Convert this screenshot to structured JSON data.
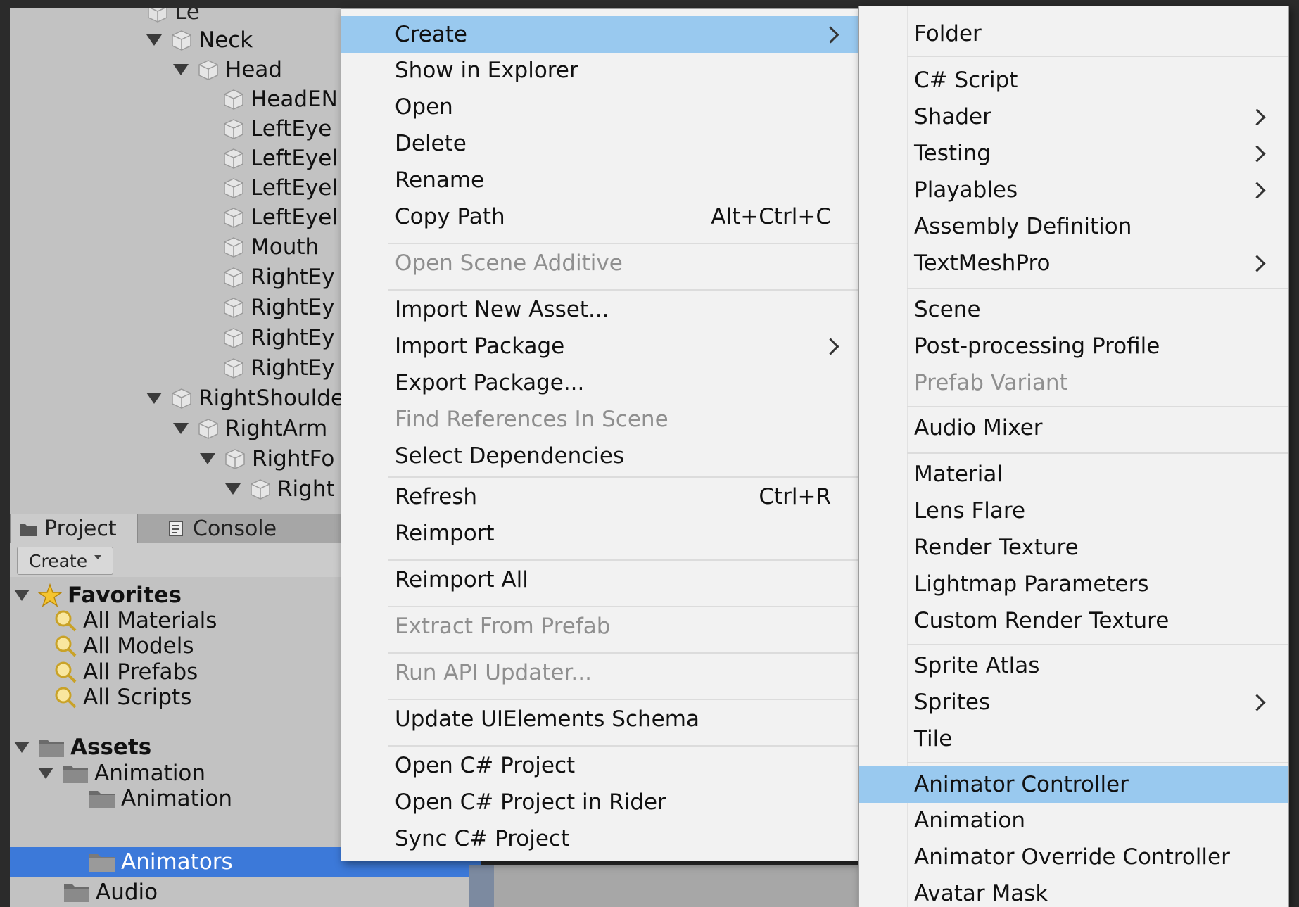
{
  "hierarchy": {
    "items": [
      {
        "label": "Neck"
      },
      {
        "label": "Head"
      },
      {
        "label": "HeadEN"
      },
      {
        "label": "LeftEye"
      },
      {
        "label": "LeftEyel"
      },
      {
        "label": "LeftEyel"
      },
      {
        "label": "LeftEyel"
      },
      {
        "label": "Mouth"
      },
      {
        "label": "RightEy"
      },
      {
        "label": "RightEy"
      },
      {
        "label": "RightEy"
      },
      {
        "label": "RightEy"
      },
      {
        "label": "RightShoulde"
      },
      {
        "label": "RightArm"
      },
      {
        "label": "RightFo"
      },
      {
        "label": "Right"
      }
    ]
  },
  "tabs": [
    {
      "label": "Project"
    },
    {
      "label": "Console"
    }
  ],
  "project_toolbar": {
    "create_label": "Create"
  },
  "project_tree": {
    "favorites_label": "Favorites",
    "favorites": [
      {
        "label": "All Materials"
      },
      {
        "label": "All Models"
      },
      {
        "label": "All Prefabs"
      },
      {
        "label": "All Scripts"
      }
    ],
    "assets_label": "Assets",
    "folders": [
      {
        "label": "Animation"
      },
      {
        "label": "Animation"
      },
      {
        "label": "Animators"
      },
      {
        "label": "Audio"
      }
    ]
  },
  "context_menu": {
    "items": [
      {
        "label": "Create",
        "submenu": true,
        "highlighted": true
      },
      {
        "label": "Show in Explorer"
      },
      {
        "label": "Open"
      },
      {
        "label": "Delete"
      },
      {
        "label": "Rename"
      },
      {
        "label": "Copy Path",
        "shortcut": "Alt+Ctrl+C"
      },
      {
        "label": "Open Scene Additive",
        "disabled": true
      },
      {
        "label": "Import New Asset..."
      },
      {
        "label": "Import Package",
        "submenu": true
      },
      {
        "label": "Export Package..."
      },
      {
        "label": "Find References In Scene",
        "disabled": true
      },
      {
        "label": "Select Dependencies"
      },
      {
        "label": "Refresh",
        "shortcut": "Ctrl+R"
      },
      {
        "label": "Reimport"
      },
      {
        "label": "Reimport All"
      },
      {
        "label": "Extract From Prefab",
        "disabled": true
      },
      {
        "label": "Run API Updater...",
        "disabled": true
      },
      {
        "label": "Update UIElements Schema"
      },
      {
        "label": "Open C# Project"
      },
      {
        "label": "Open C# Project in Rider"
      },
      {
        "label": "Sync C# Project"
      }
    ]
  },
  "create_submenu": {
    "items": [
      {
        "label": "Folder"
      },
      {
        "label": "C# Script"
      },
      {
        "label": "Shader",
        "submenu": true
      },
      {
        "label": "Testing",
        "submenu": true
      },
      {
        "label": "Playables",
        "submenu": true
      },
      {
        "label": "Assembly Definition"
      },
      {
        "label": "TextMeshPro",
        "submenu": true
      },
      {
        "label": "Scene"
      },
      {
        "label": "Post-processing Profile"
      },
      {
        "label": "Prefab Variant",
        "disabled": true
      },
      {
        "label": "Audio Mixer"
      },
      {
        "label": "Material"
      },
      {
        "label": "Lens Flare"
      },
      {
        "label": "Render Texture"
      },
      {
        "label": "Lightmap Parameters"
      },
      {
        "label": "Custom Render Texture"
      },
      {
        "label": "Sprite Atlas"
      },
      {
        "label": "Sprites",
        "submenu": true
      },
      {
        "label": "Tile"
      },
      {
        "label": "Animator Controller",
        "highlighted": true
      },
      {
        "label": "Animation"
      },
      {
        "label": "Animator Override Controller"
      },
      {
        "label": "Avatar Mask"
      }
    ]
  },
  "colors": {
    "menu_bg": "#f2f2f2",
    "menu_highlight": "#99c9ef",
    "selection_blue": "#3c79d9",
    "panel_gray": "#c2c2c2",
    "disabled_text": "#8f8f8f"
  }
}
